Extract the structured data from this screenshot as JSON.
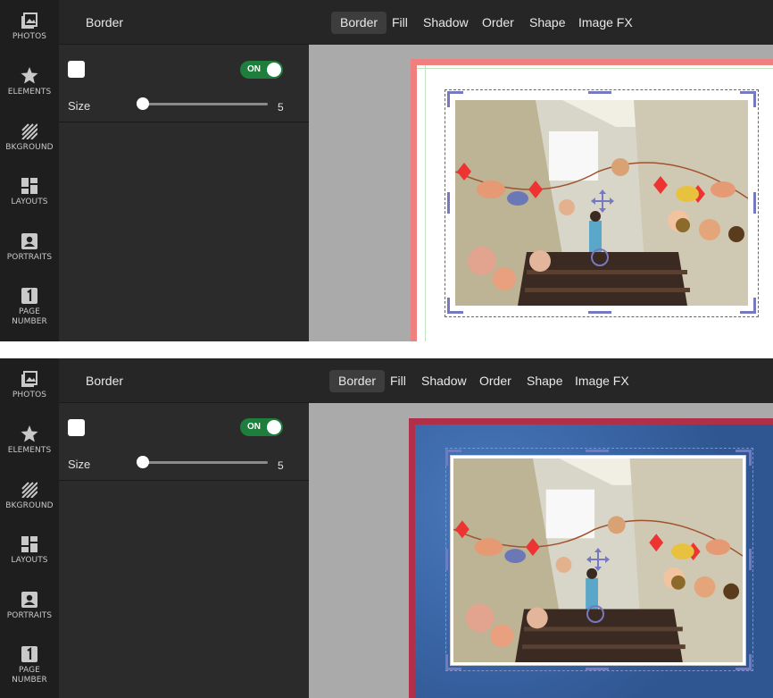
{
  "panels": [
    {
      "sidebar": {
        "items": [
          {
            "label": "PHOTOS",
            "icon": "photos-icon"
          },
          {
            "label": "ELEMENTS",
            "icon": "star-icon"
          },
          {
            "label": "BKGROUND",
            "icon": "background-icon"
          },
          {
            "label": "LAYOUTS",
            "icon": "layouts-icon"
          },
          {
            "label": "PORTRAITS",
            "icon": "portrait-icon"
          },
          {
            "label": "PAGE\nNUMBER",
            "icon": "page-number-icon"
          }
        ]
      },
      "properties": {
        "title": "Border",
        "toggle_label": "ON",
        "size_label": "Size",
        "size_value": "5",
        "size_fraction": 0.0
      },
      "tabs": [
        "Border",
        "Fill",
        "Shadow",
        "Order",
        "Shape",
        "Image FX"
      ],
      "active_tab": "Border",
      "border_style": "none"
    },
    {
      "sidebar": {
        "items": [
          {
            "label": "PHOTOS",
            "icon": "photos-icon"
          },
          {
            "label": "ELEMENTS",
            "icon": "star-icon"
          },
          {
            "label": "BKGROUND",
            "icon": "background-icon"
          },
          {
            "label": "LAYOUTS",
            "icon": "layouts-icon"
          },
          {
            "label": "PORTRAITS",
            "icon": "portrait-icon"
          },
          {
            "label": "PAGE\nNUMBER",
            "icon": "page-number-icon"
          }
        ]
      },
      "properties": {
        "title": "Border",
        "toggle_label": "ON",
        "size_label": "Size",
        "size_value": "5",
        "size_fraction": 0.0
      },
      "tabs": [
        "Border",
        "Fill",
        "Shadow",
        "Order",
        "Shape",
        "Image FX"
      ],
      "active_tab": "Border",
      "border_style": "white"
    }
  ],
  "colors": {
    "sidebar_bg": "#1e1e1e",
    "panel_bg": "#2b2b2b",
    "toggle_on": "#1e7e3c",
    "handle": "#7779c0",
    "page_border_pink": "#f08080",
    "leather_blue": "#3b67a8",
    "leather_red": "#b0304a"
  }
}
